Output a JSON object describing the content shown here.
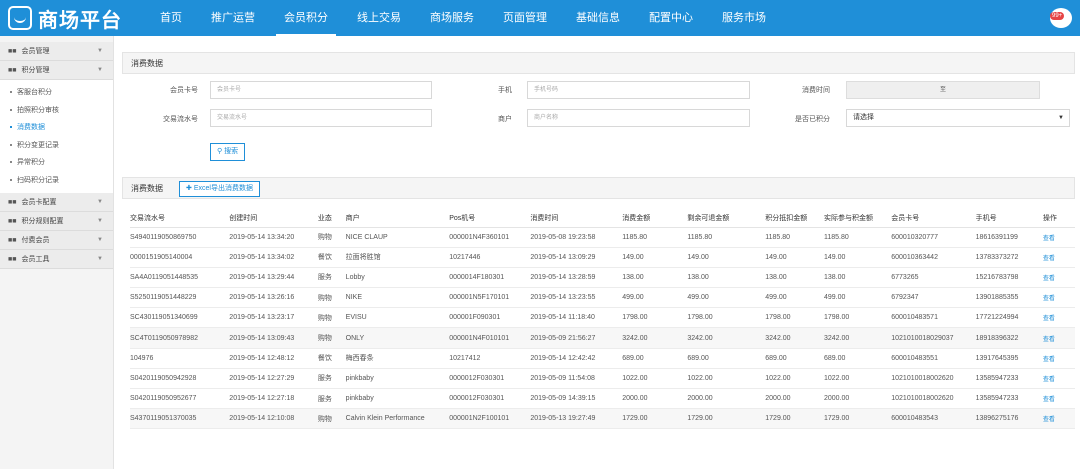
{
  "app": {
    "logo_text": "商场平台",
    "badge": "99+"
  },
  "nav": [
    "首页",
    "推广运营",
    "会员积分",
    "线上交易",
    "商场服务",
    "页面管理",
    "基础信息",
    "配置中心",
    "服务市场"
  ],
  "sidebar": {
    "groups": [
      {
        "label": "会员管理"
      },
      {
        "label": "积分管理",
        "items": [
          "客服台积分",
          "拍照积分审核",
          "消费数据",
          "积分变更记录",
          "异常积分",
          "扫码积分记录"
        ]
      },
      {
        "label": "会员卡配置"
      },
      {
        "label": "积分规则配置"
      },
      {
        "label": "付费会员"
      },
      {
        "label": "会员工具"
      }
    ]
  },
  "filter": {
    "title": "消费数据",
    "card_label": "会员卡号",
    "card_placeholder": "会员卡号",
    "phone_label": "手机",
    "phone_placeholder": "手机号码",
    "time_label": "消费时间",
    "range_sep": "至",
    "serial_label": "交易流水号",
    "serial_placeholder": "交易流水号",
    "shop_label": "商户",
    "shop_placeholder": "商户名称",
    "points_label": "是否已积分",
    "points_value": "请选择",
    "search_btn": "搜索"
  },
  "list": {
    "title": "消费数据",
    "excel_btn": "Excel导出消费数据",
    "columns": [
      "交易流水号",
      "创建时间",
      "业态",
      "商户",
      "Pos机号",
      "消费时间",
      "消费金额",
      "剩余可退金额",
      "积分抵扣金额",
      "实际参与积金额",
      "会员卡号",
      "手机号",
      "操作"
    ],
    "rows": [
      [
        "S4940119050869750",
        "2019-05-14 13:34:20",
        "购物",
        "NICE CLAUP",
        "000001N4F360101",
        "2019-05-08 19:23:58",
        "1185.80",
        "1185.80",
        "1185.80",
        "1185.80",
        "600010320777",
        "18616391199",
        "查看"
      ],
      [
        "0000151905140004",
        "2019-05-14 13:34:02",
        "餐饮",
        "拉面将胜馆",
        "10217446",
        "2019-05-14 13:09:29",
        "149.00",
        "149.00",
        "149.00",
        "149.00",
        "600010363442",
        "13783373272",
        "查看"
      ],
      [
        "SA4A0119051448535",
        "2019-05-14 13:29:44",
        "服务",
        "Lobby",
        "0000014F180301",
        "2019-05-14 13:28:59",
        "138.00",
        "138.00",
        "138.00",
        "138.00",
        "6773265",
        "15216783798",
        "查看"
      ],
      [
        "S5250119051448229",
        "2019-05-14 13:26:16",
        "购物",
        "NIKE",
        "000001N5F170101",
        "2019-05-14 13:23:55",
        "499.00",
        "499.00",
        "499.00",
        "499.00",
        "6792347",
        "13901885355",
        "查看"
      ],
      [
        "SC430119051340699",
        "2019-05-14 13:23:17",
        "购物",
        "EVISU",
        "000001F090301",
        "2019-05-14 11:18:40",
        "1798.00",
        "1798.00",
        "1798.00",
        "1798.00",
        "600010483571",
        "17721224994",
        "查看"
      ],
      [
        "SC4T0119050978982",
        "2019-05-14 13:09:43",
        "购物",
        "ONLY",
        "000001N4F010101",
        "2019-05-09 21:56:27",
        "3242.00",
        "3242.00",
        "3242.00",
        "3242.00",
        "1021010018029037",
        "18918396322",
        "查看"
      ],
      [
        "104976",
        "2019-05-14 12:48:12",
        "餐饮",
        "梅西春条",
        "10217412",
        "2019-05-14 12:42:42",
        "689.00",
        "689.00",
        "689.00",
        "689.00",
        "600010483551",
        "13917645395",
        "查看"
      ],
      [
        "S0420119050942928",
        "2019-05-14 12:27:29",
        "服务",
        "pinkbaby",
        "0000012F030301",
        "2019-05-09 11:54:08",
        "1022.00",
        "1022.00",
        "1022.00",
        "1022.00",
        "1021010018002620",
        "13585947233",
        "查看"
      ],
      [
        "S0420119050952677",
        "2019-05-14 12:27:18",
        "服务",
        "pinkbaby",
        "0000012F030301",
        "2019-05-09 14:39:15",
        "2000.00",
        "2000.00",
        "2000.00",
        "2000.00",
        "1021010018002620",
        "13585947233",
        "查看"
      ],
      [
        "S4370119051370035",
        "2019-05-14 12:10:08",
        "购物",
        "Calvin Klein Performance",
        "000001N2F100101",
        "2019-05-13 19:27:49",
        "1729.00",
        "1729.00",
        "1729.00",
        "1729.00",
        "600010483543",
        "13896275176",
        "查看"
      ]
    ]
  },
  "colors": {
    "brand": "#1f8fd8"
  }
}
